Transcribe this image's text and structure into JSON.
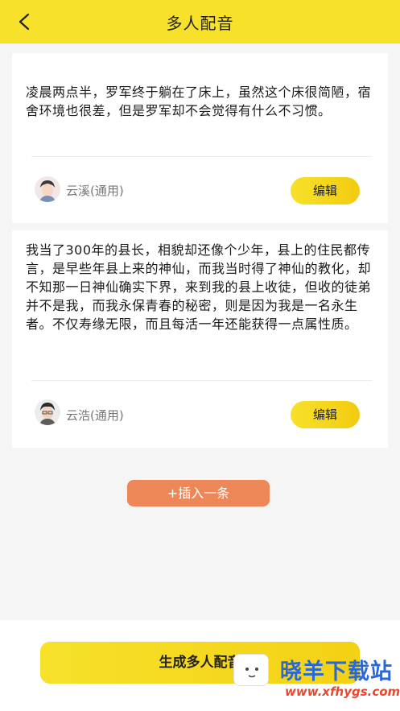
{
  "header": {
    "title": "多人配音",
    "back_icon": "chevron-left-icon",
    "background": "#f7e12a"
  },
  "cards": [
    {
      "text": "凌晨两点半，罗军终于躺在了床上，虽然这个床很简陋，宿舍环境也很差，但是罗军却不会觉得有什么不习惯。",
      "voice_name": "云溪(通用)",
      "edit_label": "编辑"
    },
    {
      "text": "我当了300年的县长，相貌却还像个少年，县上的住民都传言，是早些年县上来的神仙，而我当时得了神仙的教化，却不知那一日神仙确实下界，来到我的县上收徒，但收的徒弟并不是我，而我永保青春的秘密，则是因为我是一名永生者。不仅寿缘无限，而且每活一年还能获得一点属性质。",
      "voice_name": "云浩(通用)",
      "edit_label": "编辑"
    }
  ],
  "insert_label": "+插入一条",
  "generate_label": "生成多人配音",
  "watermark": {
    "cn": "晓羊下载站",
    "url": "www.xfhygs.com"
  },
  "colors": {
    "accent": "#f7e12a",
    "insert": "#ee8758",
    "watermark_blue": "#2a68d6",
    "watermark_red": "#e8482e"
  }
}
